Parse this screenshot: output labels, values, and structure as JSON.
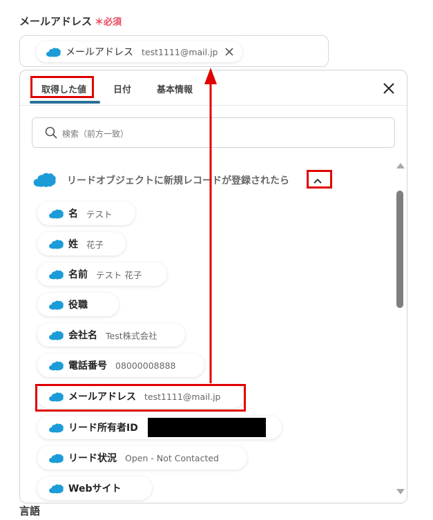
{
  "field": {
    "label": "メールアドレス",
    "required_mark": "＊",
    "required_text": "必須"
  },
  "selected_value": {
    "key": "メールアドレス",
    "value": "test1111@mail.jp"
  },
  "tabs": [
    {
      "label": "取得した値"
    },
    {
      "label": "日付"
    },
    {
      "label": "基本情報"
    }
  ],
  "search": {
    "placeholder": "検索（前方一致）"
  },
  "group": {
    "title": "リードオブジェクトに新規レコードが登録されたら"
  },
  "items": [
    {
      "key": "名",
      "value": "テスト"
    },
    {
      "key": "姓",
      "value": "花子"
    },
    {
      "key": "名前",
      "value": "テスト 花子"
    },
    {
      "key": "役職",
      "value": ""
    },
    {
      "key": "会社名",
      "value": "Test株式会社"
    },
    {
      "key": "電話番号",
      "value": "08000008888"
    },
    {
      "key": "メールアドレス",
      "value": "test1111@mail.jp"
    },
    {
      "key": "リード所有者ID",
      "value": ""
    },
    {
      "key": "リード状況",
      "value": "Open - Not Contacted"
    },
    {
      "key": "Webサイト",
      "value": ""
    }
  ],
  "footer_label": "言語",
  "colors": {
    "salesforce_cloud": "#1b9cd8",
    "highlight": "#e00000",
    "tab_accent": "#2b6f99",
    "required": "#e8475c"
  },
  "icons": [
    "salesforce-cloud-icon",
    "close-icon",
    "search-icon",
    "chevron-up-icon",
    "scroll-up-arrow",
    "scroll-down-arrow"
  ]
}
